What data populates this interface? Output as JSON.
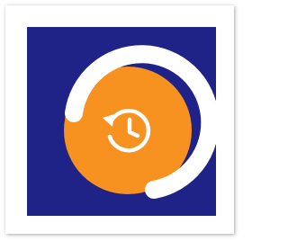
{
  "app_icon": {
    "icon": "history-icon",
    "colors": {
      "background": "#1f2286",
      "orange": "#f7911f",
      "ring": "#ffffff",
      "glyph": "#ffffff",
      "frame": "#ffffff"
    }
  }
}
